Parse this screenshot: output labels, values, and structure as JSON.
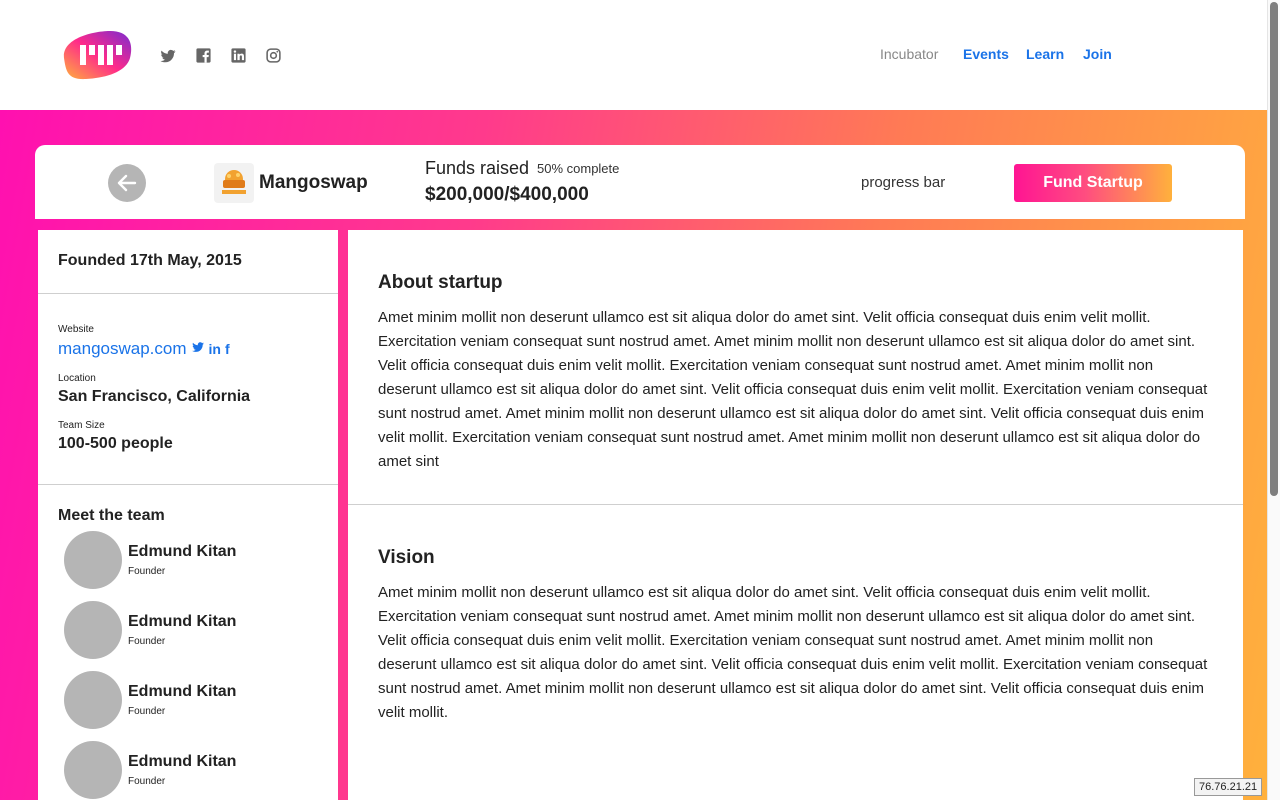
{
  "header": {
    "nav": {
      "incubator": "Incubator",
      "events": "Events",
      "learn": "Learn",
      "join": "Join"
    },
    "social_icons": [
      "twitter-icon",
      "facebook-icon",
      "linkedin-icon",
      "instagram-icon"
    ]
  },
  "topbar": {
    "startup_name": "Mangoswap",
    "funds_label": "Funds raised",
    "funds_percent": "50% complete",
    "funds_amount": "$200,000/$400,000",
    "progress_label": "progress bar",
    "fund_button": "Fund Startup"
  },
  "sidebar": {
    "founded": "Founded 17th May, 2015",
    "website_label": "Website",
    "website": "mangoswap.com",
    "location_label": "Location",
    "location": "San Francisco, California",
    "team_size_label": "Team Size",
    "team_size": "100-500 people",
    "team_heading": "Meet the team",
    "members": [
      {
        "name": "Edmund Kitan",
        "role": "Founder"
      },
      {
        "name": "Edmund Kitan",
        "role": "Founder"
      },
      {
        "name": "Edmund Kitan",
        "role": "Founder"
      },
      {
        "name": "Edmund Kitan",
        "role": "Founder"
      }
    ]
  },
  "main": {
    "about_title": "About startup",
    "about_text": "Amet minim mollit non deserunt ullamco est sit aliqua dolor do amet sint. Velit officia consequat duis enim velit mollit. Exercitation veniam consequat sunt nostrud amet. Amet minim mollit non deserunt ullamco est sit aliqua dolor do amet sint. Velit officia consequat duis enim velit mollit. Exercitation veniam consequat sunt nostrud amet. Amet minim mollit non deserunt ullamco est sit aliqua dolor do amet sint. Velit officia consequat duis enim velit mollit. Exercitation veniam consequat sunt nostrud amet. Amet minim mollit non deserunt ullamco est sit aliqua dolor do amet sint. Velit officia consequat duis enim velit mollit. Exercitation veniam consequat sunt nostrud amet. Amet minim mollit non deserunt ullamco est sit aliqua dolor do amet sint",
    "vision_title": "Vision",
    "vision_text": "Amet minim mollit non deserunt ullamco est sit aliqua dolor do amet sint. Velit officia consequat duis enim velit mollit. Exercitation veniam consequat sunt nostrud amet. Amet minim mollit non deserunt ullamco est sit aliqua dolor do amet sint. Velit officia consequat duis enim velit mollit. Exercitation veniam consequat sunt nostrud amet. Amet minim mollit non deserunt ullamco est sit aliqua dolor do amet sint. Velit officia consequat duis enim velit mollit. Exercitation veniam consequat sunt nostrud amet. Amet minim mollit non deserunt ullamco est sit aliqua dolor do amet sint. Velit officia consequat duis enim velit mollit."
  },
  "ip_badge": "76.76.21.21",
  "colors": {
    "gradient_start": "#ff10b0",
    "gradient_end": "#ffb13c",
    "link": "#1a73e8"
  }
}
